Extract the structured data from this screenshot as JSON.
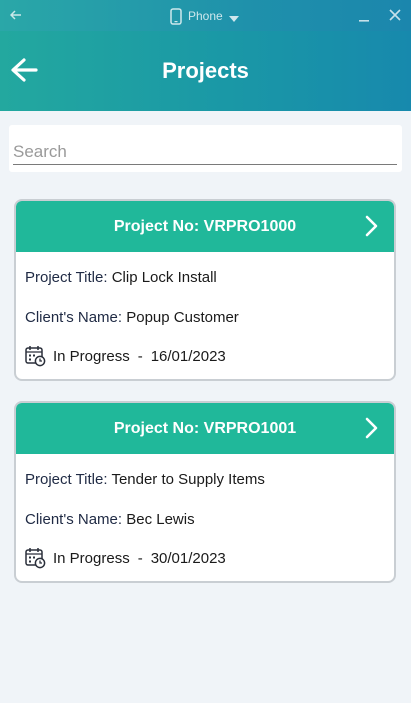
{
  "emulator": {
    "device_label": "Phone",
    "icons": {
      "back": "back-arrow-icon",
      "phone": "phone-icon",
      "caret": "caret-down-icon",
      "minimize": "minimize-icon",
      "close": "close-icon"
    }
  },
  "header": {
    "title": "Projects",
    "back_icon": "arrow-left-icon"
  },
  "search": {
    "placeholder": "Search",
    "value": ""
  },
  "colors": {
    "header_gradient_start": "#23a89f",
    "header_gradient_end": "#1789ad",
    "card_header": "#20b89a",
    "background": "#f0f4f8"
  },
  "projects": [
    {
      "header": "Project No: VRPRO1000",
      "title_label": "Project Title:",
      "title_value": "Clip Lock Install",
      "client_label": "Client's Name:",
      "client_value": "Popup Customer",
      "status": "In Progress",
      "separator": "-",
      "date": "16/01/2023"
    },
    {
      "header": "Project No: VRPRO1001",
      "title_label": "Project Title:",
      "title_value": "Tender to Supply Items",
      "client_label": "Client's Name:",
      "client_value": "Bec Lewis",
      "status": "In Progress",
      "separator": "-",
      "date": "30/01/2023"
    }
  ]
}
